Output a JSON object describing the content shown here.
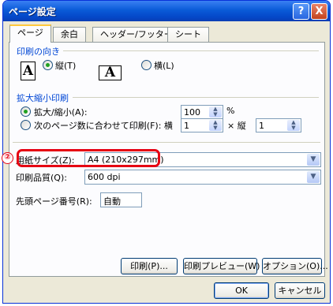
{
  "window": {
    "title": "ページ設定",
    "help_glyph": "?",
    "close_glyph": "X"
  },
  "tabs": [
    "ページ",
    "余白",
    "ヘッダー/フッター",
    "シート"
  ],
  "orientation": {
    "group_label": "印刷の向き",
    "portrait_label": "縦(T)",
    "landscape_label": "横(L)",
    "portrait_icon": "A",
    "landscape_icon": "A",
    "selected": "portrait"
  },
  "scaling": {
    "group_label": "拡大縮小印刷",
    "adjust_label": "拡大/縮小(A):",
    "adjust_value": "100",
    "percent_unit": "%",
    "fit_label": "次のページ数に合わせて印刷(F): 横",
    "fit_wide_value": "1",
    "fit_tall_label": "× 縦",
    "fit_tall_value": "1",
    "selected": "adjust"
  },
  "paper_size": {
    "label": "用紙サイズ(Z):",
    "value": "A4 (210x297mm)"
  },
  "print_quality": {
    "label": "印刷品質(Q):",
    "value": "600 dpi"
  },
  "first_page": {
    "label": "先頭ページ番号(R):",
    "value": "自動"
  },
  "panel_buttons": {
    "print": "印刷(P)...",
    "preview": "印刷プレビュー(W)",
    "options": "オプション(O)..."
  },
  "dialog_buttons": {
    "ok": "OK",
    "cancel": "キャンセル"
  },
  "annotation": {
    "badge": "②",
    "color": "#e60012"
  }
}
